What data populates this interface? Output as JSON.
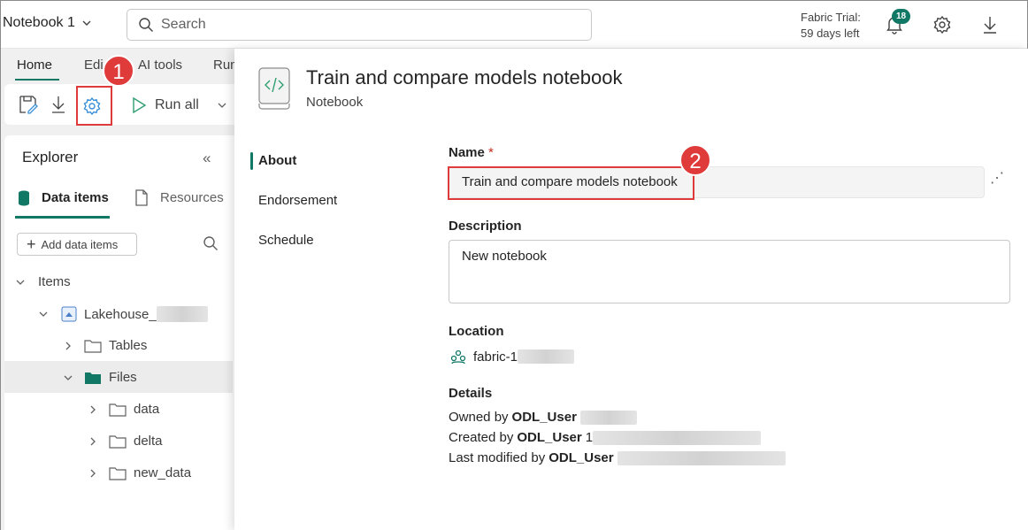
{
  "header": {
    "notebook_title": "Notebook 1",
    "search_placeholder": "Search",
    "trial_line1": "Fabric Trial:",
    "trial_line2": "59 days left",
    "notification_count": "18"
  },
  "ribbon": {
    "tabs": [
      "Home",
      "Edit",
      "AI tools",
      "Run"
    ],
    "run_all_label": "Run all"
  },
  "callouts": {
    "one": "1",
    "two": "2"
  },
  "explorer": {
    "title": "Explorer",
    "tab_data_items": "Data items",
    "tab_resources": "Resources",
    "add_button": "Add data items",
    "tree": {
      "items": "Items",
      "lakehouse": "Lakehouse_",
      "tables": "Tables",
      "files": "Files",
      "data": "data",
      "delta": "delta",
      "new_data": "new_data"
    }
  },
  "panel": {
    "title": "Train and compare models notebook",
    "subtitle": "Notebook",
    "nav": [
      "About",
      "Endorsement",
      "Schedule"
    ],
    "name_label": "Name",
    "required_mark": "*",
    "name_value": "Train and compare models notebook",
    "description_label": "Description",
    "description_value": "New notebook",
    "location_label": "Location",
    "location_value": "fabric-1",
    "details_label": "Details",
    "owned_by_prefix": "Owned by",
    "created_by_prefix": "Created by",
    "modified_by_prefix": "Last modified by",
    "user": "ODL_User",
    "created_suffix": "1"
  },
  "colors": {
    "accent": "#117865",
    "callout": "#e03b3b"
  }
}
